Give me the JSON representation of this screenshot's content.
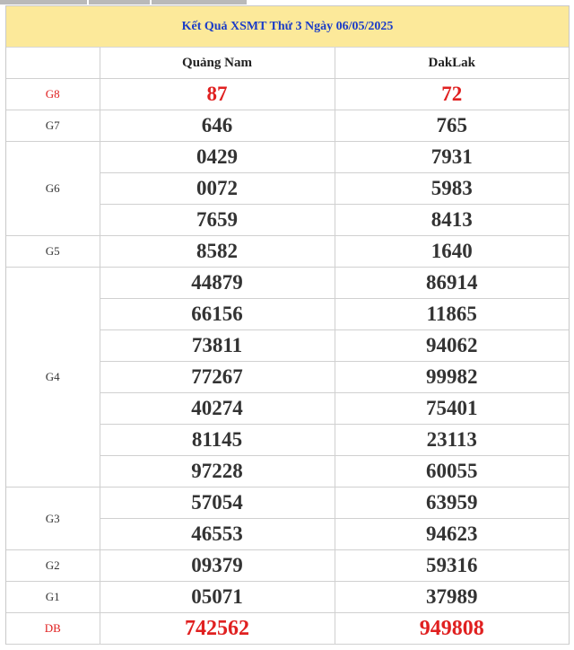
{
  "title": "Kết Quả XSMT Thứ 3 Ngày 06/05/2025",
  "provinces": [
    "Quảng Nam",
    "DakLak"
  ],
  "colors": {
    "header_bg": "#fce99a",
    "title_text": "#1a3cc8",
    "red": "#e02020"
  },
  "prizes": {
    "g8": {
      "label": "G8",
      "values": [
        [
          "87"
        ],
        [
          "72"
        ]
      ]
    },
    "g7": {
      "label": "G7",
      "values": [
        [
          "646"
        ],
        [
          "765"
        ]
      ]
    },
    "g6": {
      "label": "G6",
      "values": [
        [
          "0429",
          "0072",
          "7659"
        ],
        [
          "7931",
          "5983",
          "8413"
        ]
      ]
    },
    "g5": {
      "label": "G5",
      "values": [
        [
          "8582"
        ],
        [
          "1640"
        ]
      ]
    },
    "g4": {
      "label": "G4",
      "values": [
        [
          "44879",
          "66156",
          "73811",
          "77267",
          "40274",
          "81145",
          "97228"
        ],
        [
          "86914",
          "11865",
          "94062",
          "99982",
          "75401",
          "23113",
          "60055"
        ]
      ]
    },
    "g3": {
      "label": "G3",
      "values": [
        [
          "57054",
          "46553"
        ],
        [
          "63959",
          "94623"
        ]
      ]
    },
    "g2": {
      "label": "G2",
      "values": [
        [
          "09379"
        ],
        [
          "59316"
        ]
      ]
    },
    "g1": {
      "label": "G1",
      "values": [
        [
          "05071"
        ],
        [
          "37989"
        ]
      ]
    },
    "db": {
      "label": "DB",
      "values": [
        [
          "742562"
        ],
        [
          "949808"
        ]
      ]
    }
  }
}
